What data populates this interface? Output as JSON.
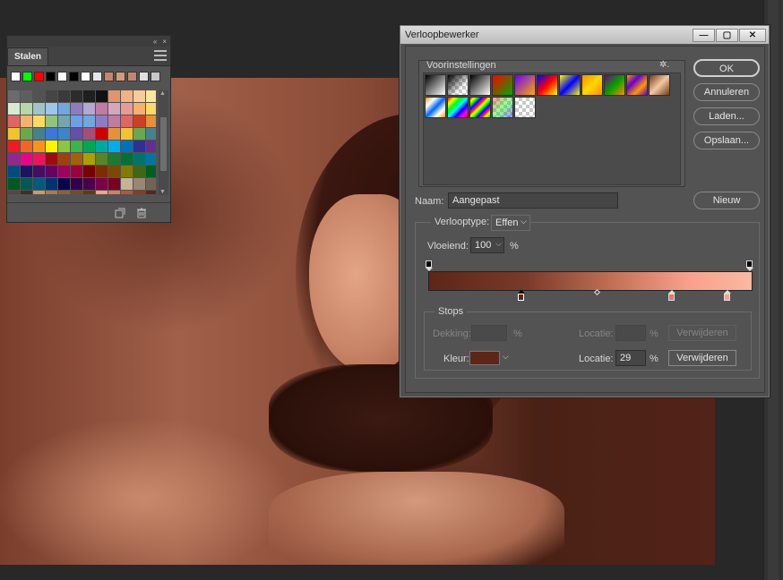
{
  "swatches_panel": {
    "collapse_glyph": "«",
    "close_glyph": "×",
    "tab_label": "Stalen",
    "recent_colors": [
      "#ffffff",
      "#00ff00",
      "#ff0000",
      "#000000",
      "#ffffff",
      "#000000",
      "#ffffff",
      "#e6e6e6",
      "#c3856c",
      "#d49a7c",
      "#c3856c",
      "#e0e0e0",
      "#c8c8c8"
    ],
    "grid_colors": [
      "#6b6b6b",
      "#5e5e5e",
      "#525252",
      "#454545",
      "#3a3a3a",
      "#2c2c2c",
      "#1f1f1f",
      "#111111",
      "#e0956e",
      "#f4b183",
      "#f9cb9c",
      "#ffe599",
      "#d9ead3",
      "#b6d7a8",
      "#a2c4c9",
      "#9fc5e8",
      "#6fa8dc",
      "#8e7cc3",
      "#b4a7d6",
      "#c27ba0",
      "#d5a6bd",
      "#ea9999",
      "#f6b26b",
      "#ffd966",
      "#e06666",
      "#f6b26b",
      "#ffd966",
      "#93c47d",
      "#76a5af",
      "#6d9eeb",
      "#6fa8dc",
      "#8e7cc3",
      "#c27ba0",
      "#e06666",
      "#cc4125",
      "#e69138",
      "#f1c232",
      "#6aa84f",
      "#45818e",
      "#3c78d8",
      "#3d85c6",
      "#674ea7",
      "#a64d79",
      "#cc0000",
      "#e69138",
      "#f1c232",
      "#6aa84f",
      "#45818e",
      "#ed1c24",
      "#f26522",
      "#f7941d",
      "#fff200",
      "#8dc63f",
      "#39b54a",
      "#00a651",
      "#00a99d",
      "#00aeef",
      "#0072bc",
      "#2e3192",
      "#662d91",
      "#92278f",
      "#ec008c",
      "#ed145b",
      "#9e0b0f",
      "#a0410d",
      "#a36209",
      "#aba000",
      "#598527",
      "#1a7b30",
      "#007236",
      "#00746b",
      "#0076a3",
      "#004b80",
      "#1b1464",
      "#440e62",
      "#630460",
      "#9e005d",
      "#9e0039",
      "#790000",
      "#7b2e00",
      "#7d4900",
      "#827b00",
      "#406618",
      "#005e20",
      "#005826",
      "#005952",
      "#005b7f",
      "#003471",
      "#0d004c",
      "#32004b",
      "#4b0049",
      "#7b0046",
      "#7a0026",
      "#c7b299",
      "#998675",
      "#736357",
      "#534741",
      "#37302d",
      "#c69c6d",
      "#a67c52",
      "#8c6239",
      "#754c24",
      "#603913",
      "#f7a08c",
      "#e07a5f",
      "#b5563a",
      "#8a3a26",
      "#5c2618"
    ],
    "footer_new_icon": "new-swatch-icon",
    "footer_trash_icon": "trash-icon"
  },
  "editor": {
    "title": "Verloopbewerker",
    "presets_label": "Voorinstellingen",
    "gear_glyph": "✲.",
    "presets": [
      "linear-gradient(135deg,#000,#fff)",
      "checker-fg-transparent",
      "linear-gradient(135deg,#000,#fff)",
      "linear-gradient(135deg,#ff0000,#00aa00)",
      "linear-gradient(135deg,#6a00ff,#ffaa00)",
      "linear-gradient(135deg,#0000ff,#ff0000,#ffff00)",
      "linear-gradient(135deg,#ffff00,#0000ff,#ffff00)",
      "linear-gradient(135deg,#ff8c00,#ffd700,#ff8c00)",
      "linear-gradient(135deg,#7a0080,#00a000,#ff8c00)",
      "linear-gradient(135deg,#ff9900,#6600cc,#ff9900,#6600cc)",
      "linear-gradient(135deg,#6e3b1c,#f4c7a1,#6e3b1c)",
      "linear-gradient(135deg,#ff9900,#ffffff,#0066ff,#ffffff,#ff9900)",
      "linear-gradient(135deg,#ff0000,#ffff00,#00ff00,#00ffff,#0000ff,#ff00ff,#ff0000)",
      "repeating-linear-gradient(135deg,#ff0000 0,#ffff00 3px,#00ff00 6px,#0000ff 9px,#ff00ff 12px)",
      "checker-rainbow",
      "checker-plain"
    ],
    "buttons": {
      "ok": "OK",
      "cancel": "Annuleren",
      "load": "Laden...",
      "save": "Opslaan...",
      "new": "Nieuw"
    },
    "name_label": "Naam:",
    "name_value": "Aangepast",
    "gradient_type_label": "Verlooptype:",
    "gradient_type_value": "Effen",
    "smoothness_label": "Vloeiend:",
    "smoothness_value": "100",
    "percent": "%",
    "gradient_colors": [
      "#5c2618",
      "#7a3a28",
      "#c8775c",
      "#f7a08c",
      "#f9b9a0"
    ],
    "stops_label": "Stops",
    "opacity_label": "Dekking:",
    "opacity_value": "",
    "location_label": "Locatie:",
    "location_opacity_value": "",
    "delete_label": "Verwijderen",
    "color_label": "Kleur:",
    "color_value": "#5c2618",
    "location_color_value": "29"
  }
}
